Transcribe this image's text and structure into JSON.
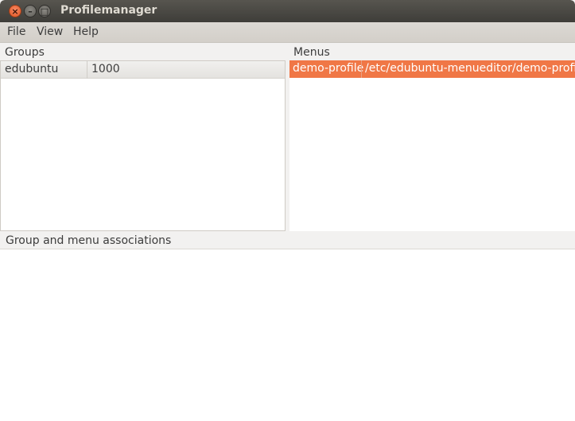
{
  "window": {
    "title": "Profilemanager",
    "controls": {
      "close": "×",
      "minimize": "–",
      "maximize": "□"
    }
  },
  "menubar": {
    "items": [
      "File",
      "View",
      "Help"
    ]
  },
  "groups": {
    "label": "Groups",
    "rows": [
      {
        "name": "edubuntu",
        "id": "1000"
      }
    ]
  },
  "menus": {
    "label": "Menus",
    "rows": [
      {
        "name": "demo-profile",
        "path": "/etc/edubuntu-menueditor/demo-profile",
        "selected": true
      }
    ]
  },
  "associations": {
    "label": "Group and menu associations"
  },
  "colors": {
    "selection": "#f07746",
    "titlebar": "#3e3d39"
  }
}
